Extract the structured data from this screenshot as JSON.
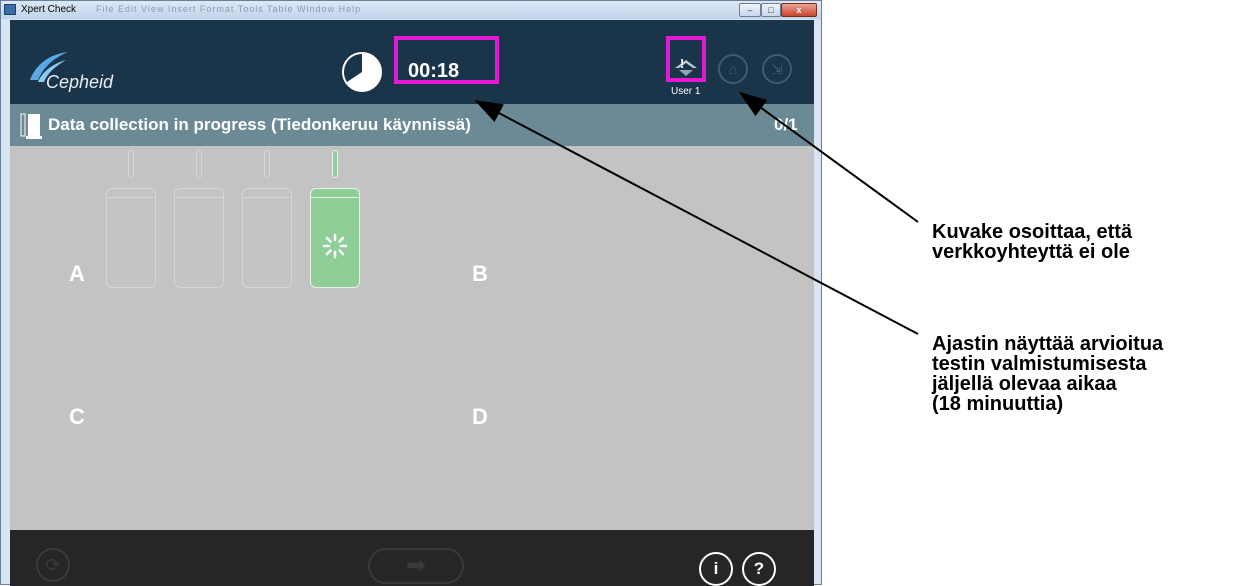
{
  "window": {
    "title": "Xpert Check",
    "menu_text": "File  Edit  View  Insert  Format  Tools  Table  Window  Help",
    "min_glyph": "–",
    "max_glyph": "□",
    "close_glyph": "x"
  },
  "header": {
    "logo_text": "Cepheid",
    "timer": "00:18",
    "network_glyph": "!",
    "user_label": "User 1",
    "home_icon": "home-icon",
    "exit_icon": "exit-icon"
  },
  "status": {
    "text": "Data collection in progress  (Tiedonkeruu käynnissä)",
    "count": "0/1"
  },
  "modules": {
    "count": 4,
    "active_index": 3,
    "accent": "#8fce97"
  },
  "quadrants": [
    "A",
    "B",
    "C",
    "D"
  ],
  "footer": {
    "refresh_glyph": "⟳",
    "next_glyph": "➡",
    "info_glyph": "i",
    "help_glyph": "?"
  },
  "annotations": {
    "highlight_color": "#e21ad6",
    "network_callout": [
      "Kuvake osoittaa, että",
      "verkkoyhteyttä ei ole"
    ],
    "timer_callout": [
      "Ajastin näyttää arvioitua",
      "testin valmistumisesta",
      "jäljellä olevaa aikaa",
      "(18 minuuttia)"
    ]
  }
}
